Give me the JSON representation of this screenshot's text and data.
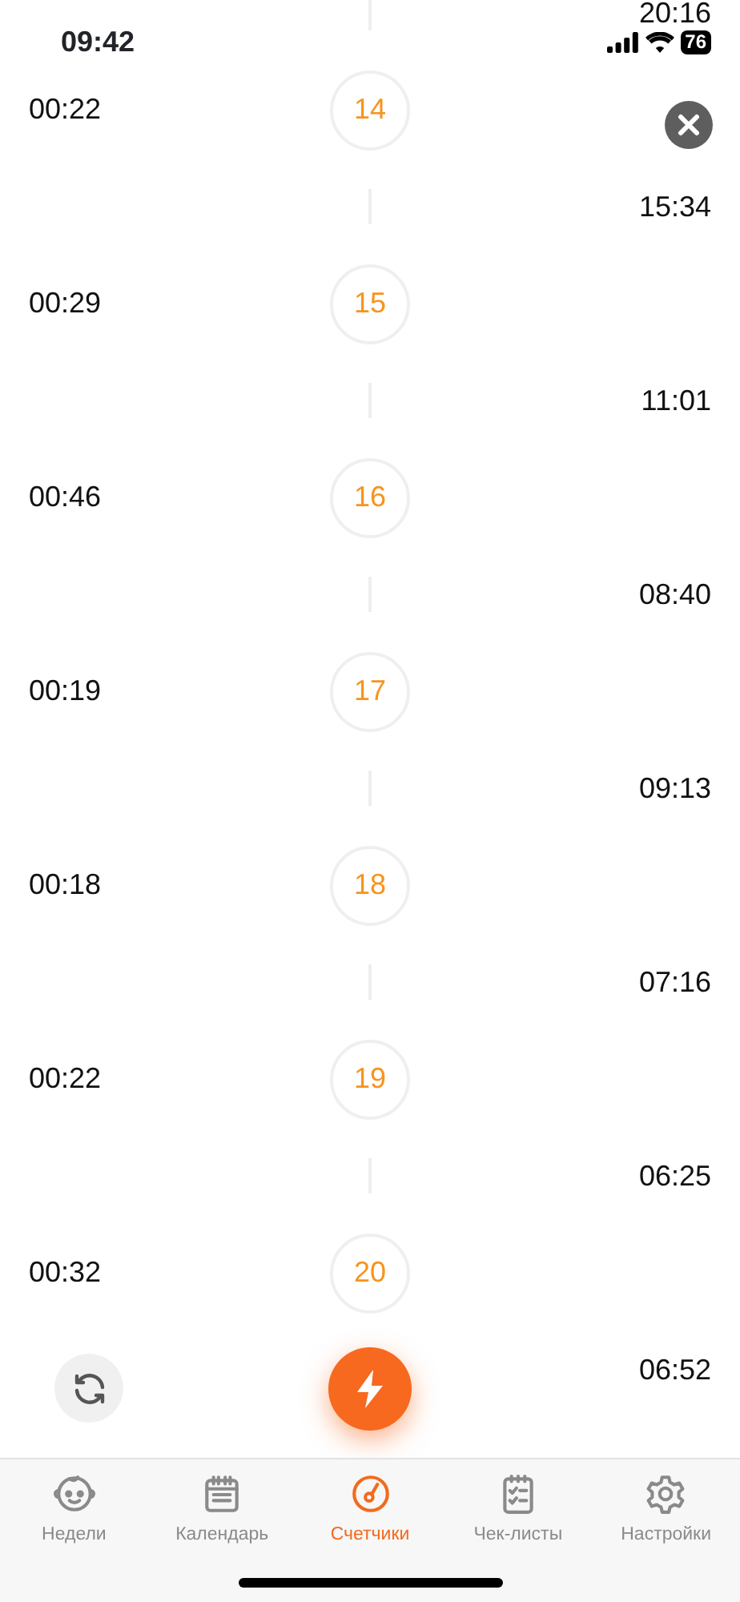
{
  "status_bar": {
    "time": "09:42",
    "battery": "76"
  },
  "top_time": "20:16",
  "entries": [
    {
      "count": "14",
      "duration": "00:22",
      "time": "15:34"
    },
    {
      "count": "15",
      "duration": "00:29",
      "time": "11:01"
    },
    {
      "count": "16",
      "duration": "00:46",
      "time": "08:40"
    },
    {
      "count": "17",
      "duration": "00:19",
      "time": "09:13"
    },
    {
      "count": "18",
      "duration": "00:18",
      "time": "07:16"
    },
    {
      "count": "19",
      "duration": "00:22",
      "time": "06:25"
    },
    {
      "count": "20",
      "duration": "00:32",
      "time": "06:52"
    }
  ],
  "tabs": [
    {
      "label": "Недели",
      "selected": false
    },
    {
      "label": "Календарь",
      "selected": false
    },
    {
      "label": "Счетчики",
      "selected": true
    },
    {
      "label": "Чек-листы",
      "selected": false
    },
    {
      "label": "Настройки",
      "selected": false
    }
  ]
}
